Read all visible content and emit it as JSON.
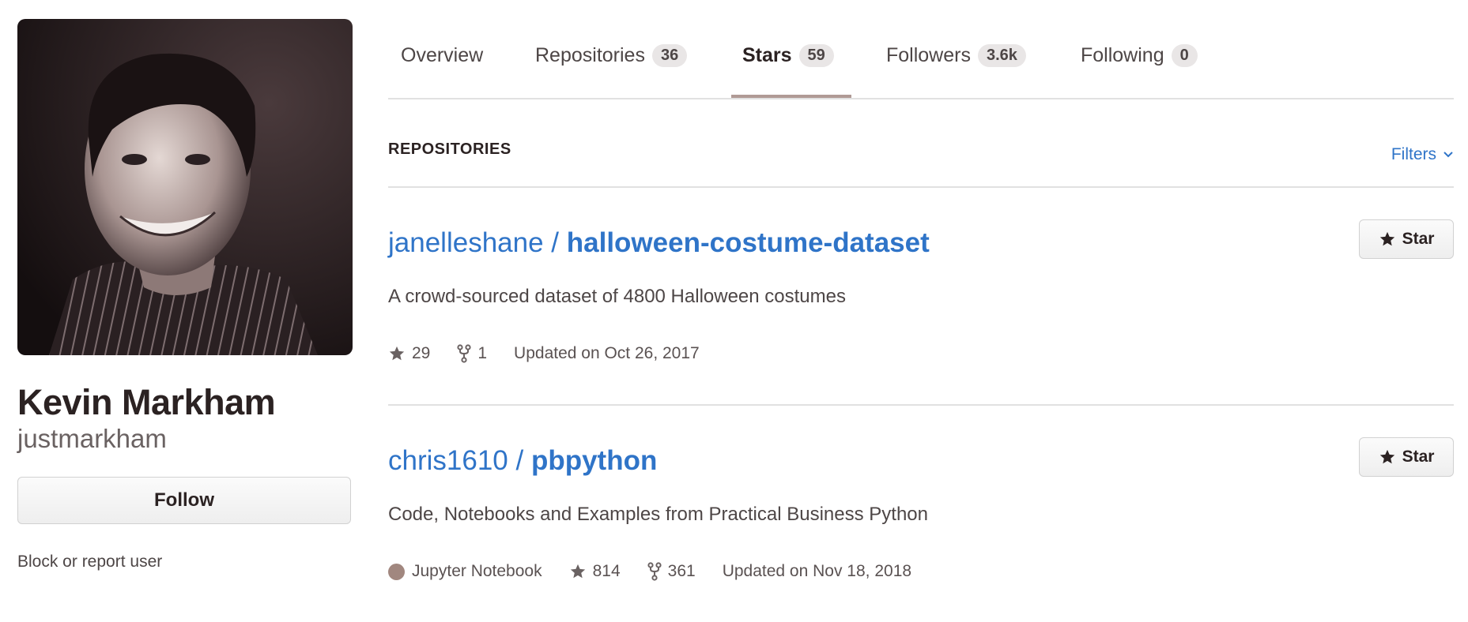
{
  "profile": {
    "fullname": "Kevin Markham",
    "username": "justmarkham",
    "follow_label": "Follow",
    "block_label": "Block or report user"
  },
  "tabs": [
    {
      "label": "Overview",
      "count": null
    },
    {
      "label": "Repositories",
      "count": "36"
    },
    {
      "label": "Stars",
      "count": "59",
      "selected": true
    },
    {
      "label": "Followers",
      "count": "3.6k"
    },
    {
      "label": "Following",
      "count": "0"
    }
  ],
  "section": {
    "title": "REPOSITORIES",
    "filters_label": "Filters"
  },
  "repos": [
    {
      "owner": "janelleshane",
      "separator": " / ",
      "name": "halloween-costume-dataset",
      "description": "A crowd-sourced dataset of 4800 Halloween costumes",
      "language": null,
      "stars": "29",
      "forks": "1",
      "updated": "Updated on Oct 26, 2017",
      "star_label": "Star"
    },
    {
      "owner": "chris1610",
      "separator": " / ",
      "name": "pbpython",
      "description": "Code, Notebooks and Examples from Practical Business Python",
      "language": "Jupyter Notebook",
      "language_color": "#a1877f",
      "stars": "814",
      "forks": "361",
      "updated": "Updated on Nov 18, 2018",
      "star_label": "Star"
    }
  ],
  "colors": {
    "link": "#2f74c8",
    "tab_underline": "#b09a95"
  }
}
